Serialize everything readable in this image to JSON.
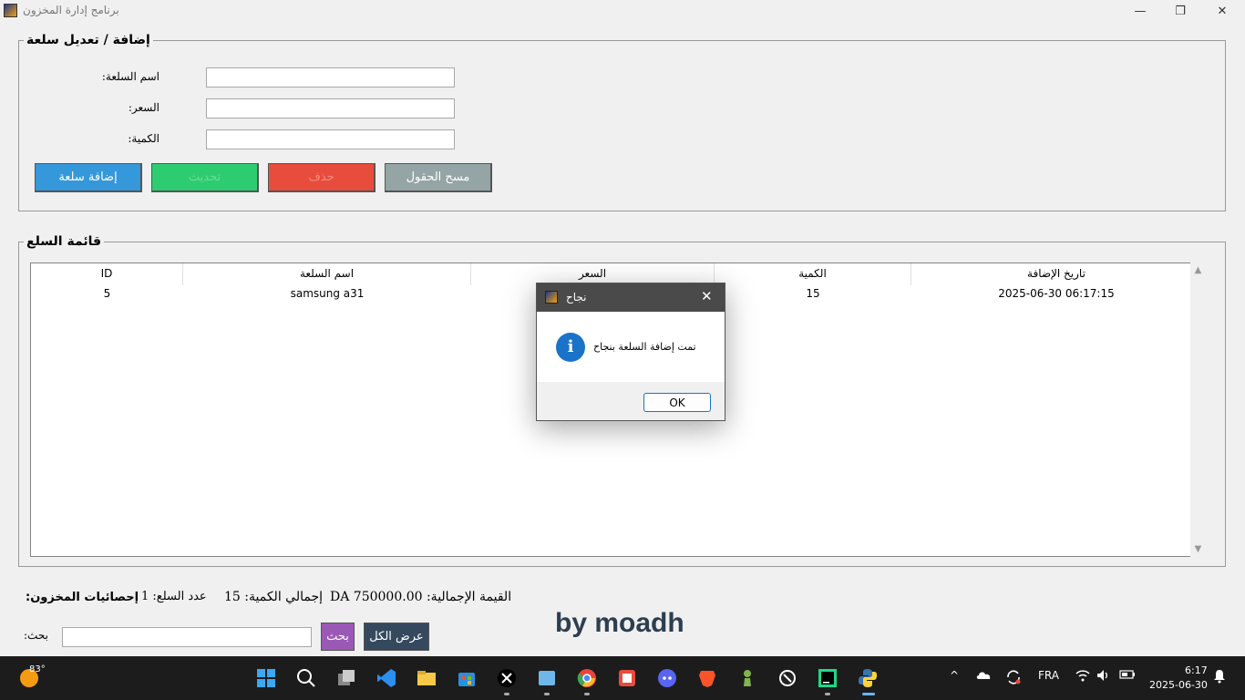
{
  "window": {
    "title": "برنامج إدارة المخزون",
    "min": "—",
    "max": "❐",
    "close": "✕"
  },
  "form": {
    "legend": "إضافة / تعديل سلعة",
    "name_label": ":اسم السلعة",
    "price_label": ":السعر",
    "qty_label": ":الكمية",
    "name_value": "",
    "price_value": "",
    "qty_value": "",
    "add_label": "إضافة سلعة",
    "update_label": "تحديث",
    "delete_label": "حذف",
    "clear_label": "مسح الحقول"
  },
  "list": {
    "legend": "قائمة السلع",
    "columns": [
      "ID",
      "اسم السلعة",
      "السعر",
      "الكمية",
      "تاريخ الإضافة"
    ],
    "rows": [
      {
        "id": "5",
        "name": "samsung a31",
        "price": "",
        "qty": "15",
        "date": "2025-06-30 06:17:15"
      }
    ],
    "scroll_up": "▲",
    "scroll_down": "▼"
  },
  "stats": {
    "title": ":إحصائيات المخزون",
    "count": "عدد السلع: 1",
    "total_qty": "إجمالي الكمية: 15",
    "total_value": "DA القيمة الإجمالية: 750000.00"
  },
  "search": {
    "label": ":بحث",
    "value": "",
    "search_label": "بحث",
    "show_all_label": "عرض الكل"
  },
  "byline": "by moadh",
  "dialog": {
    "title": "نجاح",
    "close": "✕",
    "info_glyph": "i",
    "message": "تمت إضافة السلعة بنجاح",
    "ok_label": "OK"
  },
  "taskbar": {
    "temperature": "83°",
    "icons": [
      "windows-start-icon",
      "search-icon",
      "task-view-icon",
      "vscode-icon",
      "file-explorer-icon",
      "store-icon",
      "x-icon",
      "app-icon",
      "chrome-icon",
      "app2-icon",
      "discord-icon",
      "brave-icon",
      "chess-icon",
      "app3-icon",
      "pycharm-icon",
      "python-icon"
    ],
    "tray_chevron": "^",
    "language": "FRA",
    "time": "6:17",
    "date": "2025-06-30"
  }
}
